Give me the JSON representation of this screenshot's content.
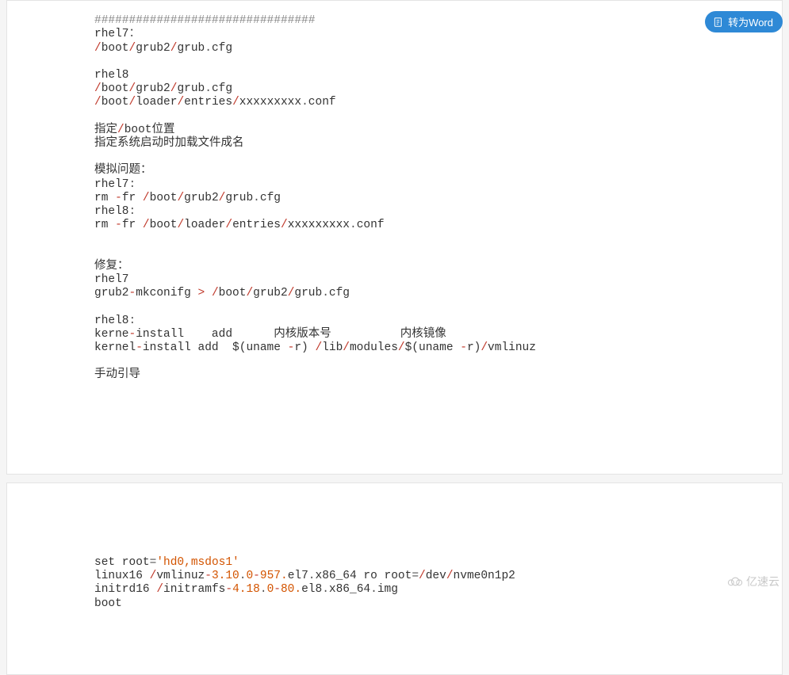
{
  "button": {
    "convert_word": "转为Word"
  },
  "watermark": {
    "brand": "亿速云"
  },
  "block1": {
    "l01": "################################",
    "l02a": "rhel7",
    "l02b": "：",
    "l03a": "/",
    "l03b": "boot",
    "l03c": "/",
    "l03d": "grub2",
    "l03e": "/",
    "l03f": "grub",
    "l03g": ".",
    "l03h": "cfg",
    "l04": "",
    "l05": "rhel8",
    "l06a": "/",
    "l06b": "boot",
    "l06c": "/",
    "l06d": "grub2",
    "l06e": "/",
    "l06f": "grub",
    "l06g": ".",
    "l06h": "cfg",
    "l07a": "/",
    "l07b": "boot",
    "l07c": "/",
    "l07d": "loader",
    "l07e": "/",
    "l07f": "entries",
    "l07g": "/",
    "l07h": "xxxxxxxxx",
    "l07i": ".",
    "l07j": "conf",
    "l08": "",
    "l09a": "指定",
    "l09b": "/",
    "l09c": "boot位置",
    "l10": "指定系统启动时加载文件成名",
    "l11": "",
    "l12": "模拟问题：",
    "l13a": "rhel7",
    "l13b": ":",
    "l14pre": "rm ",
    "l14a": "-",
    "l14b": "fr ",
    "l14c": "/",
    "l14d": "boot",
    "l14e": "/",
    "l14f": "grub2",
    "l14g": "/",
    "l14h": "grub",
    "l14i": ".",
    "l14j": "cfg",
    "l15a": "rhel8",
    "l15b": ":",
    "l16pre": "rm ",
    "l16a": "-",
    "l16b": "fr ",
    "l16c": "/",
    "l16d": "boot",
    "l16e": "/",
    "l16f": "loader",
    "l16g": "/",
    "l16h": "entries",
    "l16i": "/",
    "l16j": "xxxxxxxxx",
    "l16k": ".",
    "l16l": "conf",
    "l17": "",
    "l18": "",
    "l19": "修复：",
    "l20": "rhel7",
    "l21a": "grub2",
    "l21b": "-",
    "l21c": "mkconifg ",
    "l21d": ">",
    "l21e": " ",
    "l21f": "/",
    "l21g": "boot",
    "l21h": "/",
    "l21i": "grub2",
    "l21j": "/",
    "l21k": "grub",
    "l21l": ".",
    "l21m": "cfg",
    "l22": "",
    "l23a": "rhel8",
    "l23b": ":",
    "l24a": "kerne",
    "l24b": "-",
    "l24c": "install    add      内核版本号          内核镜像",
    "l25a": "kernel",
    "l25b": "-",
    "l25c": "install add  $(uname ",
    "l25d": "-",
    "l25e": "r) ",
    "l25f": "/",
    "l25g": "lib",
    "l25h": "/",
    "l25i": "modules",
    "l25j": "/",
    "l25k": "$(uname ",
    "l25l": "-",
    "l25m": "r)",
    "l25n": "/",
    "l25o": "vmlinuz",
    "l26": "",
    "l27": "手动引导"
  },
  "block2": {
    "l01a": "set root",
    "l01b": "=",
    "l01c": "'hd0,msdos1'",
    "l02a": "linux16 ",
    "l02b": "/",
    "l02c": "vmlinuz",
    "l02d": "-",
    "l02e": "3.10",
    "l02f": ".",
    "l02g": "0",
    "l02h": "-",
    "l02i": "957.",
    "l02j": "el7",
    "l02k": ".",
    "l02l": "x86_64 ro root",
    "l02m": "=",
    "l02n": "/",
    "l02o": "dev",
    "l02p": "/",
    "l02q": "nvme0n1p2",
    "l03a": "initrd16 ",
    "l03b": "/",
    "l03c": "initramfs",
    "l03d": "-",
    "l03e": "4.18",
    "l03f": ".",
    "l03g": "0",
    "l03h": "-",
    "l03i": "80.",
    "l03j": "el8",
    "l03k": ".",
    "l03l": "x86_64",
    "l03m": ".",
    "l03n": "img",
    "l04": "boot"
  }
}
